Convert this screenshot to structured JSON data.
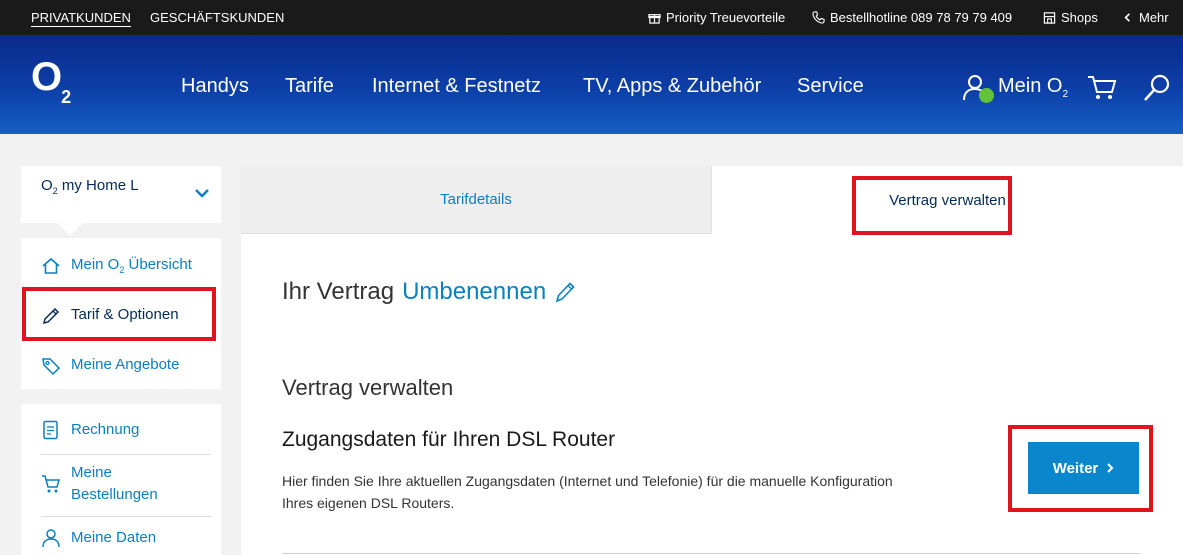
{
  "topbar": {
    "segments": [
      "PRIVATKUNDEN",
      "GESCHÄFTSKUNDEN"
    ],
    "priority": "Priority Treuevorteile",
    "hotline": "Bestellhotline 089 78 79 79 409",
    "shops": "Shops",
    "more": "Mehr"
  },
  "header": {
    "logo": "O",
    "logo_sub": "2",
    "nav": [
      "Handys",
      "Tarife",
      "Internet & Festnetz",
      "TV, Apps & Zubehör",
      "Service"
    ],
    "account_label": "Mein O",
    "account_sub": "2"
  },
  "sidebar": {
    "plan_select": {
      "prefix": "O",
      "sub": "2",
      "label": " my Home L"
    },
    "group1": [
      {
        "label": "Mein O",
        "sub": "2",
        "suffix": " Übersicht",
        "icon": "home-icon"
      },
      {
        "label": "Tarif & Optionen",
        "icon": "pencil-icon",
        "active": true
      },
      {
        "label": "Meine Angebote",
        "icon": "tag-icon"
      }
    ],
    "group2": [
      {
        "label": "Rechnung",
        "icon": "invoice-icon"
      },
      {
        "label": "Meine Bestellungen",
        "line1": "Meine",
        "line2": "Bestellungen",
        "icon": "cart-icon"
      },
      {
        "label": "Meine Daten",
        "icon": "user-icon"
      }
    ]
  },
  "tabs": {
    "tariff_details": "Tarifdetails",
    "manage_contract": "Vertrag verwalten"
  },
  "main": {
    "contract_prefix": "Ihr Vertrag",
    "rename_label": "Umbenennen",
    "section_title": "Vertrag verwalten",
    "dsl_title": "Zugangsdaten für Ihren DSL Router",
    "dsl_desc": "Hier finden Sie Ihre aktuellen Zugangsdaten (Internet und Telefonie) für die manuelle Konfiguration Ihres eigenen DSL Routers.",
    "button_label": "Weiter"
  },
  "colors": {
    "accent": "#0a87cc",
    "brand_blue": "#0c3fa8",
    "highlight": "#e1141e",
    "dark_text": "#032b5a"
  }
}
